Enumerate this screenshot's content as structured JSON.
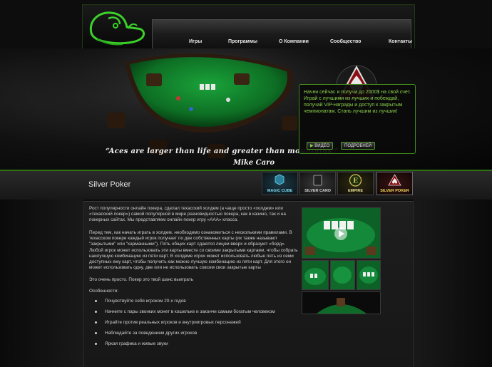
{
  "nav": {
    "items": [
      {
        "label": "Игры"
      },
      {
        "label": "Программы"
      },
      {
        "label": "О Компании"
      },
      {
        "label": "Сообщество"
      },
      {
        "label": "Контакты"
      }
    ]
  },
  "promo": {
    "text": "Начни сейчас и получи до 2000$ на свой счет. Играй с лучшими из лучших и побеждай, получай VIP-награды и доступ к закрытым чемпионатам. Стань лучшим из лучших!",
    "video_label": "ВИДЕО",
    "details_label": "ПОДРОБНЕЙ"
  },
  "quote": {
    "text": "“Aces are larger than life and greater than mountains.”",
    "author": "Mike Caro"
  },
  "section": {
    "title": "Silver Poker",
    "games": [
      {
        "label": "MAGIC CUBE",
        "accent": "#2aa9c8"
      },
      {
        "label": "SILVER CARD",
        "accent": "#b8b8b8"
      },
      {
        "label": "EMPIRE",
        "accent": "#d9c45b"
      },
      {
        "label": "SILVER POKER",
        "accent": "#e6d36b"
      }
    ]
  },
  "content": {
    "p1": "Рост популярности онлайн покера, сделал техасский холдем (а чаще просто «холдем» или «техасский покер») самой популярной в мире разновидностью покера, как в казино, так и на покерных сайтах. Мы представляем онлайн покер игру «AAA» класса.",
    "p2": "Перед тем, как начать играть в холдем, необходимо ознакомиться с несколькими правилами. В техасском покере каждый игрок получает по две собственных карты (их также называют \"закрытыми\" или \"карманными\"). Пять общих карт сдаются лицом вверх и образуют «борд». Любой игрок может использовать эти карты вместе со своими закрытыми картами, чтобы собрать наилучшую комбинацию из пяти карт. В холдеме игрок может использовать любые пять из семи доступных ему карт, чтобы получить как можно лучшую комбинацию из пяти карт. Для этого он может использовать одну, две или не использовать совсем свои закрытые карты",
    "p3": "Это очень просто. Покер это твой шанс выиграть",
    "features_title": "Особенности:",
    "features": [
      "Почувствуйте себя игроком 20-х годов",
      "Начните с пары звонких монет в кошельке и закончи самым богатым человеком",
      "Играйте против реальных игроков и внутриигровых персонажей",
      "Наблюдайте за поведением других игроков",
      "Яркая графика и живые звуки"
    ]
  },
  "colors": {
    "accent_green": "#3f8d1b",
    "promo_text": "#8ad04b",
    "felt": "#127a2a"
  }
}
